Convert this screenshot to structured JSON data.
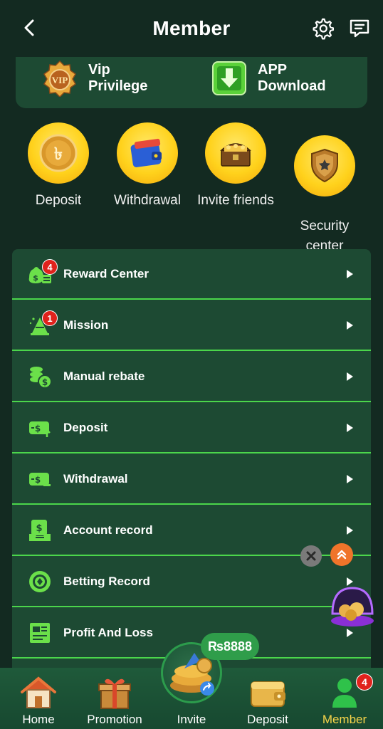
{
  "header": {
    "title": "Member"
  },
  "promo": {
    "vip_label": "Vip\nPrivilege",
    "app_label": "APP\nDownload"
  },
  "quick_actions": [
    {
      "label": "Deposit",
      "icon": "taka-coin-icon"
    },
    {
      "label": "Withdrawal",
      "icon": "wallet-icon"
    },
    {
      "label": "Invite friends",
      "icon": "treasure-chest-icon"
    },
    {
      "label": "Security\ncenter",
      "icon": "police-badge-icon"
    }
  ],
  "menu": [
    {
      "label": "Reward Center",
      "icon": "money-bag-icon",
      "badge": "4"
    },
    {
      "label": "Mission",
      "icon": "tree-icon",
      "badge": "1"
    },
    {
      "label": "Manual rebate",
      "icon": "coins-stack-icon"
    },
    {
      "label": "Deposit",
      "icon": "deposit-card-icon"
    },
    {
      "label": "Withdrawal",
      "icon": "withdrawal-card-icon"
    },
    {
      "label": "Account record",
      "icon": "account-record-icon"
    },
    {
      "label": "Betting Record",
      "icon": "chip-icon"
    },
    {
      "label": "Profit And Loss",
      "icon": "report-icon"
    }
  ],
  "reward_pill": "₨8888",
  "bottom_nav": [
    {
      "label": "Home",
      "icon": "house-icon"
    },
    {
      "label": "Promotion",
      "icon": "gift-box-icon"
    },
    {
      "label": "Invite",
      "icon": "coin-share-icon"
    },
    {
      "label": "Deposit",
      "icon": "gold-wallet-icon"
    },
    {
      "label": "Member",
      "icon": "person-icon",
      "badge": "4",
      "active": true
    }
  ],
  "colors": {
    "background": "#132a21",
    "card": "#1d4a33",
    "accent_green": "#4bd64b",
    "active_gold": "#f7d44a",
    "badge_red": "#e0221c"
  }
}
